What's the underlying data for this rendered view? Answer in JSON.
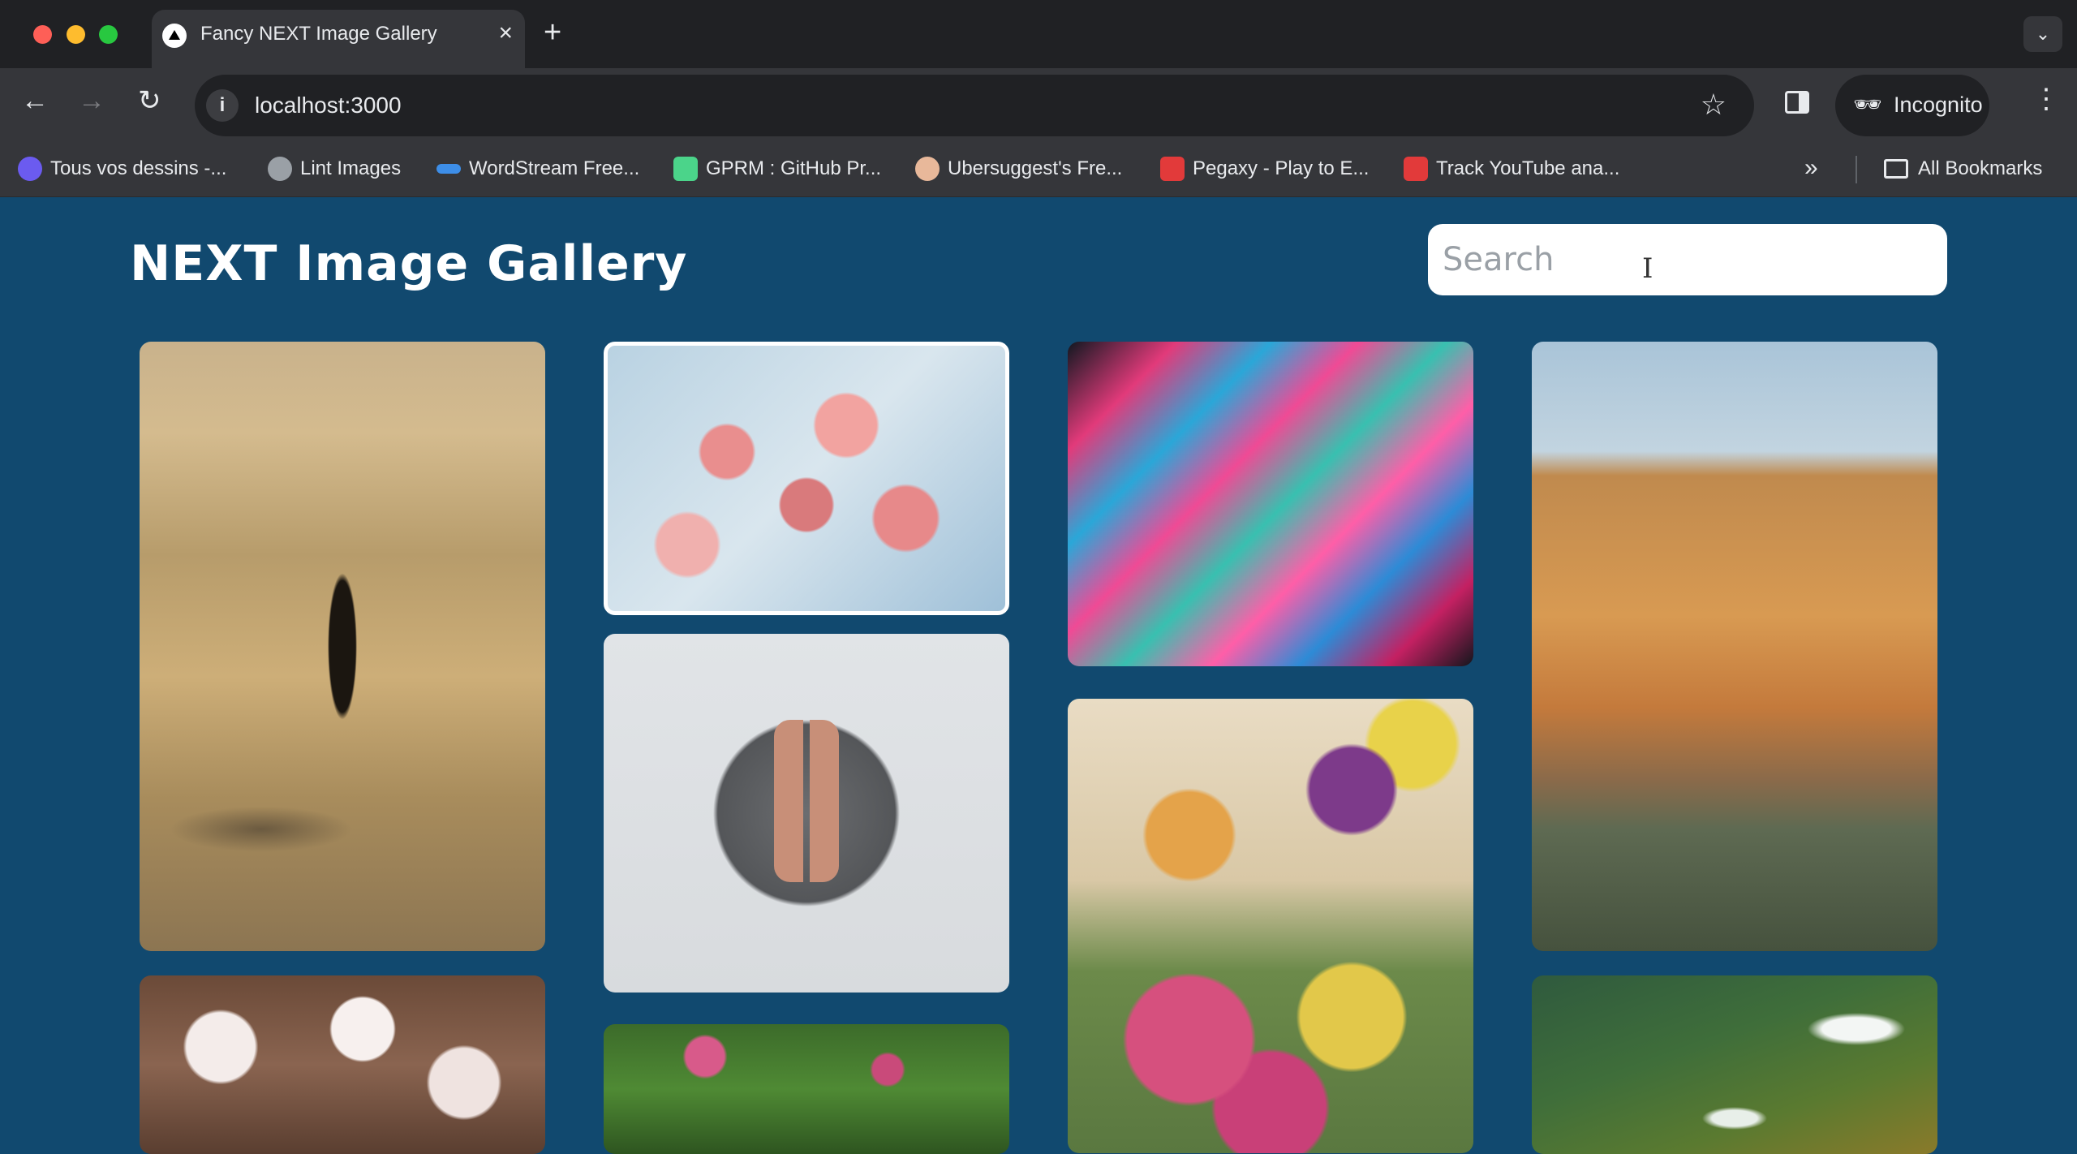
{
  "browser": {
    "tab_title": "Fancy NEXT Image Gallery",
    "url": "localhost:3000",
    "profile_label": "Incognito",
    "bookmarks": [
      {
        "label": "Tous vos dessins -...",
        "icon": "canva-icon",
        "color": "#6b5bf0"
      },
      {
        "label": "Lint Images",
        "icon": "globe-icon",
        "color": "#9aa0a6"
      },
      {
        "label": "WordStream Free...",
        "icon": "wordstream-icon",
        "color": "#3d8ee8"
      },
      {
        "label": "GPRM : GitHub Pr...",
        "icon": "gprm-icon",
        "color": "#4bd48a"
      },
      {
        "label": "Ubersuggest's Fre...",
        "icon": "ubersuggest-icon",
        "color": "#e8b89a"
      },
      {
        "label": "Pegaxy - Play to E...",
        "icon": "pegaxy-icon",
        "color": "#e23a3a"
      },
      {
        "label": "Track YouTube ana...",
        "icon": "chart-bars-icon",
        "color": "#e23a3a"
      }
    ],
    "all_bookmarks_label": "All Bookmarks"
  },
  "page": {
    "title": "NEXT Image Gallery",
    "search_placeholder": "Search",
    "background_color": "#11496f"
  },
  "gallery": {
    "images": [
      {
        "name": "gallery-image-man-in-water",
        "description": "person standing in shallow water"
      },
      {
        "name": "gallery-image-cherry-blossoms",
        "description": "pink cherry blossoms against sky"
      },
      {
        "name": "gallery-image-colorful-blur",
        "description": "colorful motion blur"
      },
      {
        "name": "gallery-image-florence-bridge",
        "description": "buildings along river"
      },
      {
        "name": "gallery-image-legs-circle",
        "description": "legs in circular frame"
      },
      {
        "name": "gallery-image-tulips",
        "description": "tulip bouquets in crates"
      },
      {
        "name": "gallery-image-white-blossoms",
        "description": "white blossoms"
      },
      {
        "name": "gallery-image-garden",
        "description": "green garden with pink flowers"
      },
      {
        "name": "gallery-image-ocean",
        "description": "aerial ocean waves"
      }
    ]
  }
}
